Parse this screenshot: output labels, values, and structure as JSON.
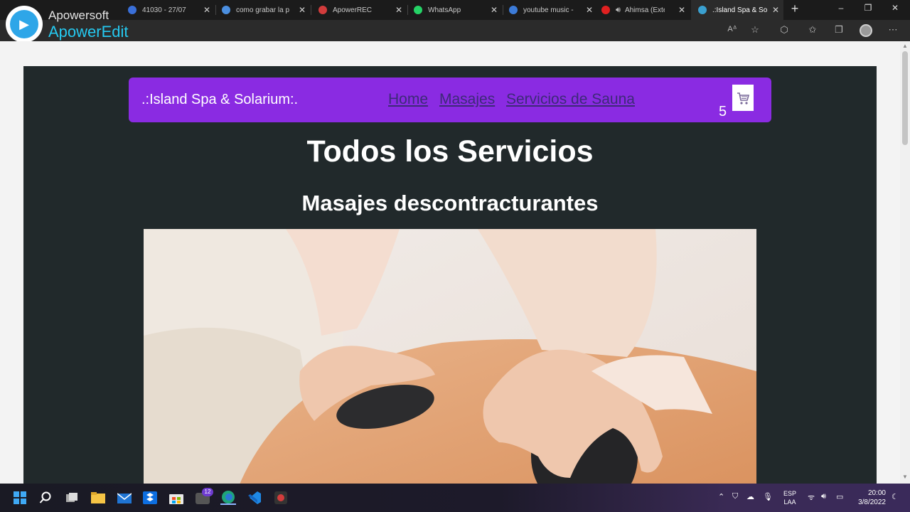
{
  "watermark": {
    "brand_top": "Apowersoft",
    "brand_bottom": "ApowerEdit"
  },
  "browser": {
    "tabs": [
      {
        "label": "41030 - 27/07",
        "icon_color": "#3a6fd8"
      },
      {
        "label": "como grabar la p",
        "icon_color": "#4b8fe0"
      },
      {
        "label": "ApowerREC",
        "icon_color": "#d23c3c"
      },
      {
        "label": "WhatsApp",
        "icon_color": "#25d366"
      },
      {
        "label": "youtube music -",
        "icon_color": "#3c7bd8"
      },
      {
        "label": "Ahimsa (Exte",
        "icon_color": "#e02020"
      },
      {
        "label": ".:Island Spa & So",
        "icon_color": "#3aa0d0"
      }
    ],
    "new_tab": "+",
    "window_controls": {
      "minimize": "–",
      "restore": "❐",
      "close": "✕"
    }
  },
  "site": {
    "brand": ".:Island Spa & Solarium:.",
    "nav": {
      "home": "Home",
      "masajes": "Masajes",
      "sauna": "Servicios de Sauna"
    },
    "cart_count": "5",
    "title": "Todos los Servicios",
    "section_title": "Masajes descontracturantes"
  },
  "taskbar": {
    "lang_top": "ESP",
    "lang_bottom": "LAA",
    "time": "20:00",
    "date": "3/8/2022",
    "notification_badge": "12"
  }
}
